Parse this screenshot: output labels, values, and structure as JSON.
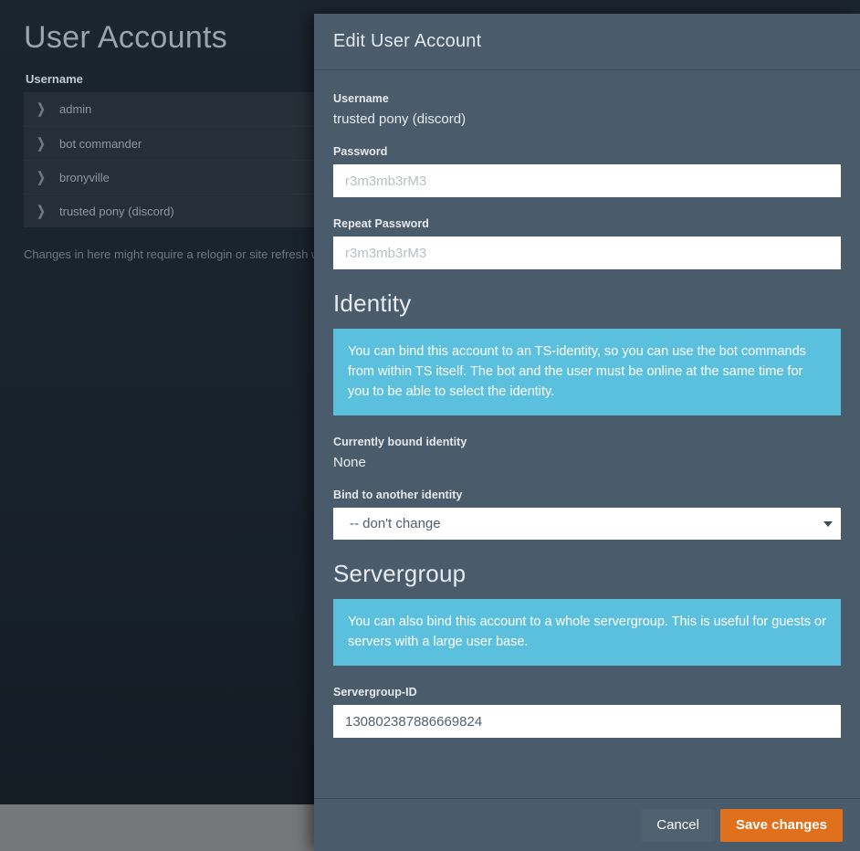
{
  "background_page": {
    "title": "User Accounts",
    "table": {
      "column_header": "Username",
      "rows": [
        {
          "name": "admin",
          "chevron": "chevron-right-icon"
        },
        {
          "name": "bot commander",
          "chevron": "chevron-right-icon"
        },
        {
          "name": "bronyville",
          "chevron": "chevron-right-icon"
        },
        {
          "name": "trusted pony (discord)",
          "chevron": "chevron-right-icon"
        }
      ]
    },
    "note": "Changes in here might require a relogin or site refresh whe"
  },
  "modal": {
    "title": "Edit User Account",
    "username": {
      "label": "Username",
      "value": "trusted pony (discord)"
    },
    "password": {
      "label": "Password",
      "value": "",
      "placeholder": "r3m3mb3rM3"
    },
    "repeat_password": {
      "label": "Repeat Password",
      "value": "",
      "placeholder": "r3m3mb3rM3"
    },
    "identity": {
      "heading": "Identity",
      "info": "You can bind this account to an TS-identity, so you can use the bot commands from within TS itself. The bot and the user must be online at the same time for you to be able to select the identity.",
      "bound_label": "Currently bound identity",
      "bound_value": "None",
      "select_label": "Bind to another identity",
      "select_value": "-- don't change",
      "select_arrow": "chevron-down-icon"
    },
    "servergroup": {
      "heading": "Servergroup",
      "info": "You can also bind this account to a whole servergroup. This is useful for guests or servers with a large user base.",
      "id_label": "Servergroup-ID",
      "id_value": "130802387886669824",
      "id_placeholder": ""
    },
    "footer": {
      "cancel_label": "Cancel",
      "save_label": "Save changes"
    }
  },
  "colors": {
    "page_background": "#151e26",
    "panel_background": "#1a242e",
    "row_background": "#262f38",
    "modal_background": "#4a5b6b",
    "info_box": "#5bc0de",
    "accent_save": "#e0701b",
    "cancel_button": "#4f606f",
    "backdrop_strip": "#767778"
  }
}
